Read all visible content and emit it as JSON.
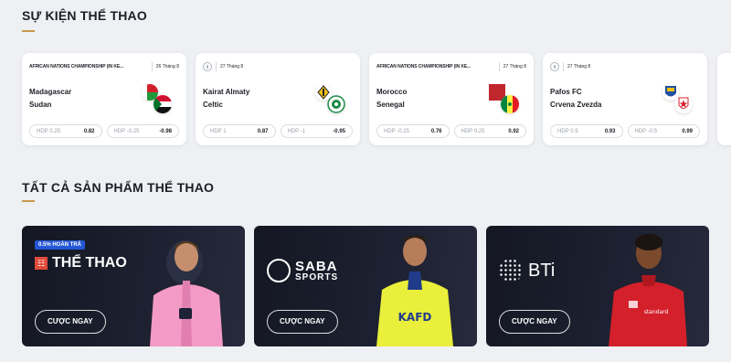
{
  "sections": {
    "events_title": "SỰ KIỆN THỂ THAO",
    "products_title": "TẤT CẢ SẢN PHẨM THỂ THAO"
  },
  "events": [
    {
      "league": "AFRICAN NATIONS CHAMPIONSHIP (IN KE...",
      "date": "26 Tháng 8",
      "home": "Madagascar",
      "away": "Sudan",
      "odds": [
        {
          "label": "HDP 0.25",
          "value": "0.82"
        },
        {
          "label": "HDP -0.25",
          "value": "-0.98"
        }
      ]
    },
    {
      "league": "",
      "date": "27 Tháng 8",
      "home": "Kairat Almaty",
      "away": "Celtic",
      "odds": [
        {
          "label": "HDP 1",
          "value": "0.87"
        },
        {
          "label": "HDP -1",
          "value": "-0.95"
        }
      ]
    },
    {
      "league": "AFRICAN NATIONS CHAMPIONSHIP (IN KE...",
      "date": "27 Tháng 8",
      "home": "Morocco",
      "away": "Senegal",
      "odds": [
        {
          "label": "HDP -0.25",
          "value": "0.76"
        },
        {
          "label": "HDP 0.25",
          "value": "0.92"
        }
      ]
    },
    {
      "league": "",
      "date": "27 Tháng 8",
      "home": "Pafos FC",
      "away": "Crvena Zvezda",
      "odds": [
        {
          "label": "HDP 0.5",
          "value": "0.93"
        },
        {
          "label": "HDP -0.5",
          "value": "0.99"
        }
      ]
    }
  ],
  "products": [
    {
      "promo": "0.5% HOÀN TRẢ",
      "brand": "THỂ THAO",
      "cta": "CƯỢC NGAY"
    },
    {
      "brand_top": "SABA",
      "brand_bottom": "SPORTS",
      "cta": "CƯỢC NGAY"
    },
    {
      "brand": "BTi",
      "cta": "CƯỢC NGAY"
    }
  ],
  "colors": {
    "accent": "#c79a4a",
    "promo_blue": "#2457d6",
    "page_bg": "#eef0f4"
  }
}
